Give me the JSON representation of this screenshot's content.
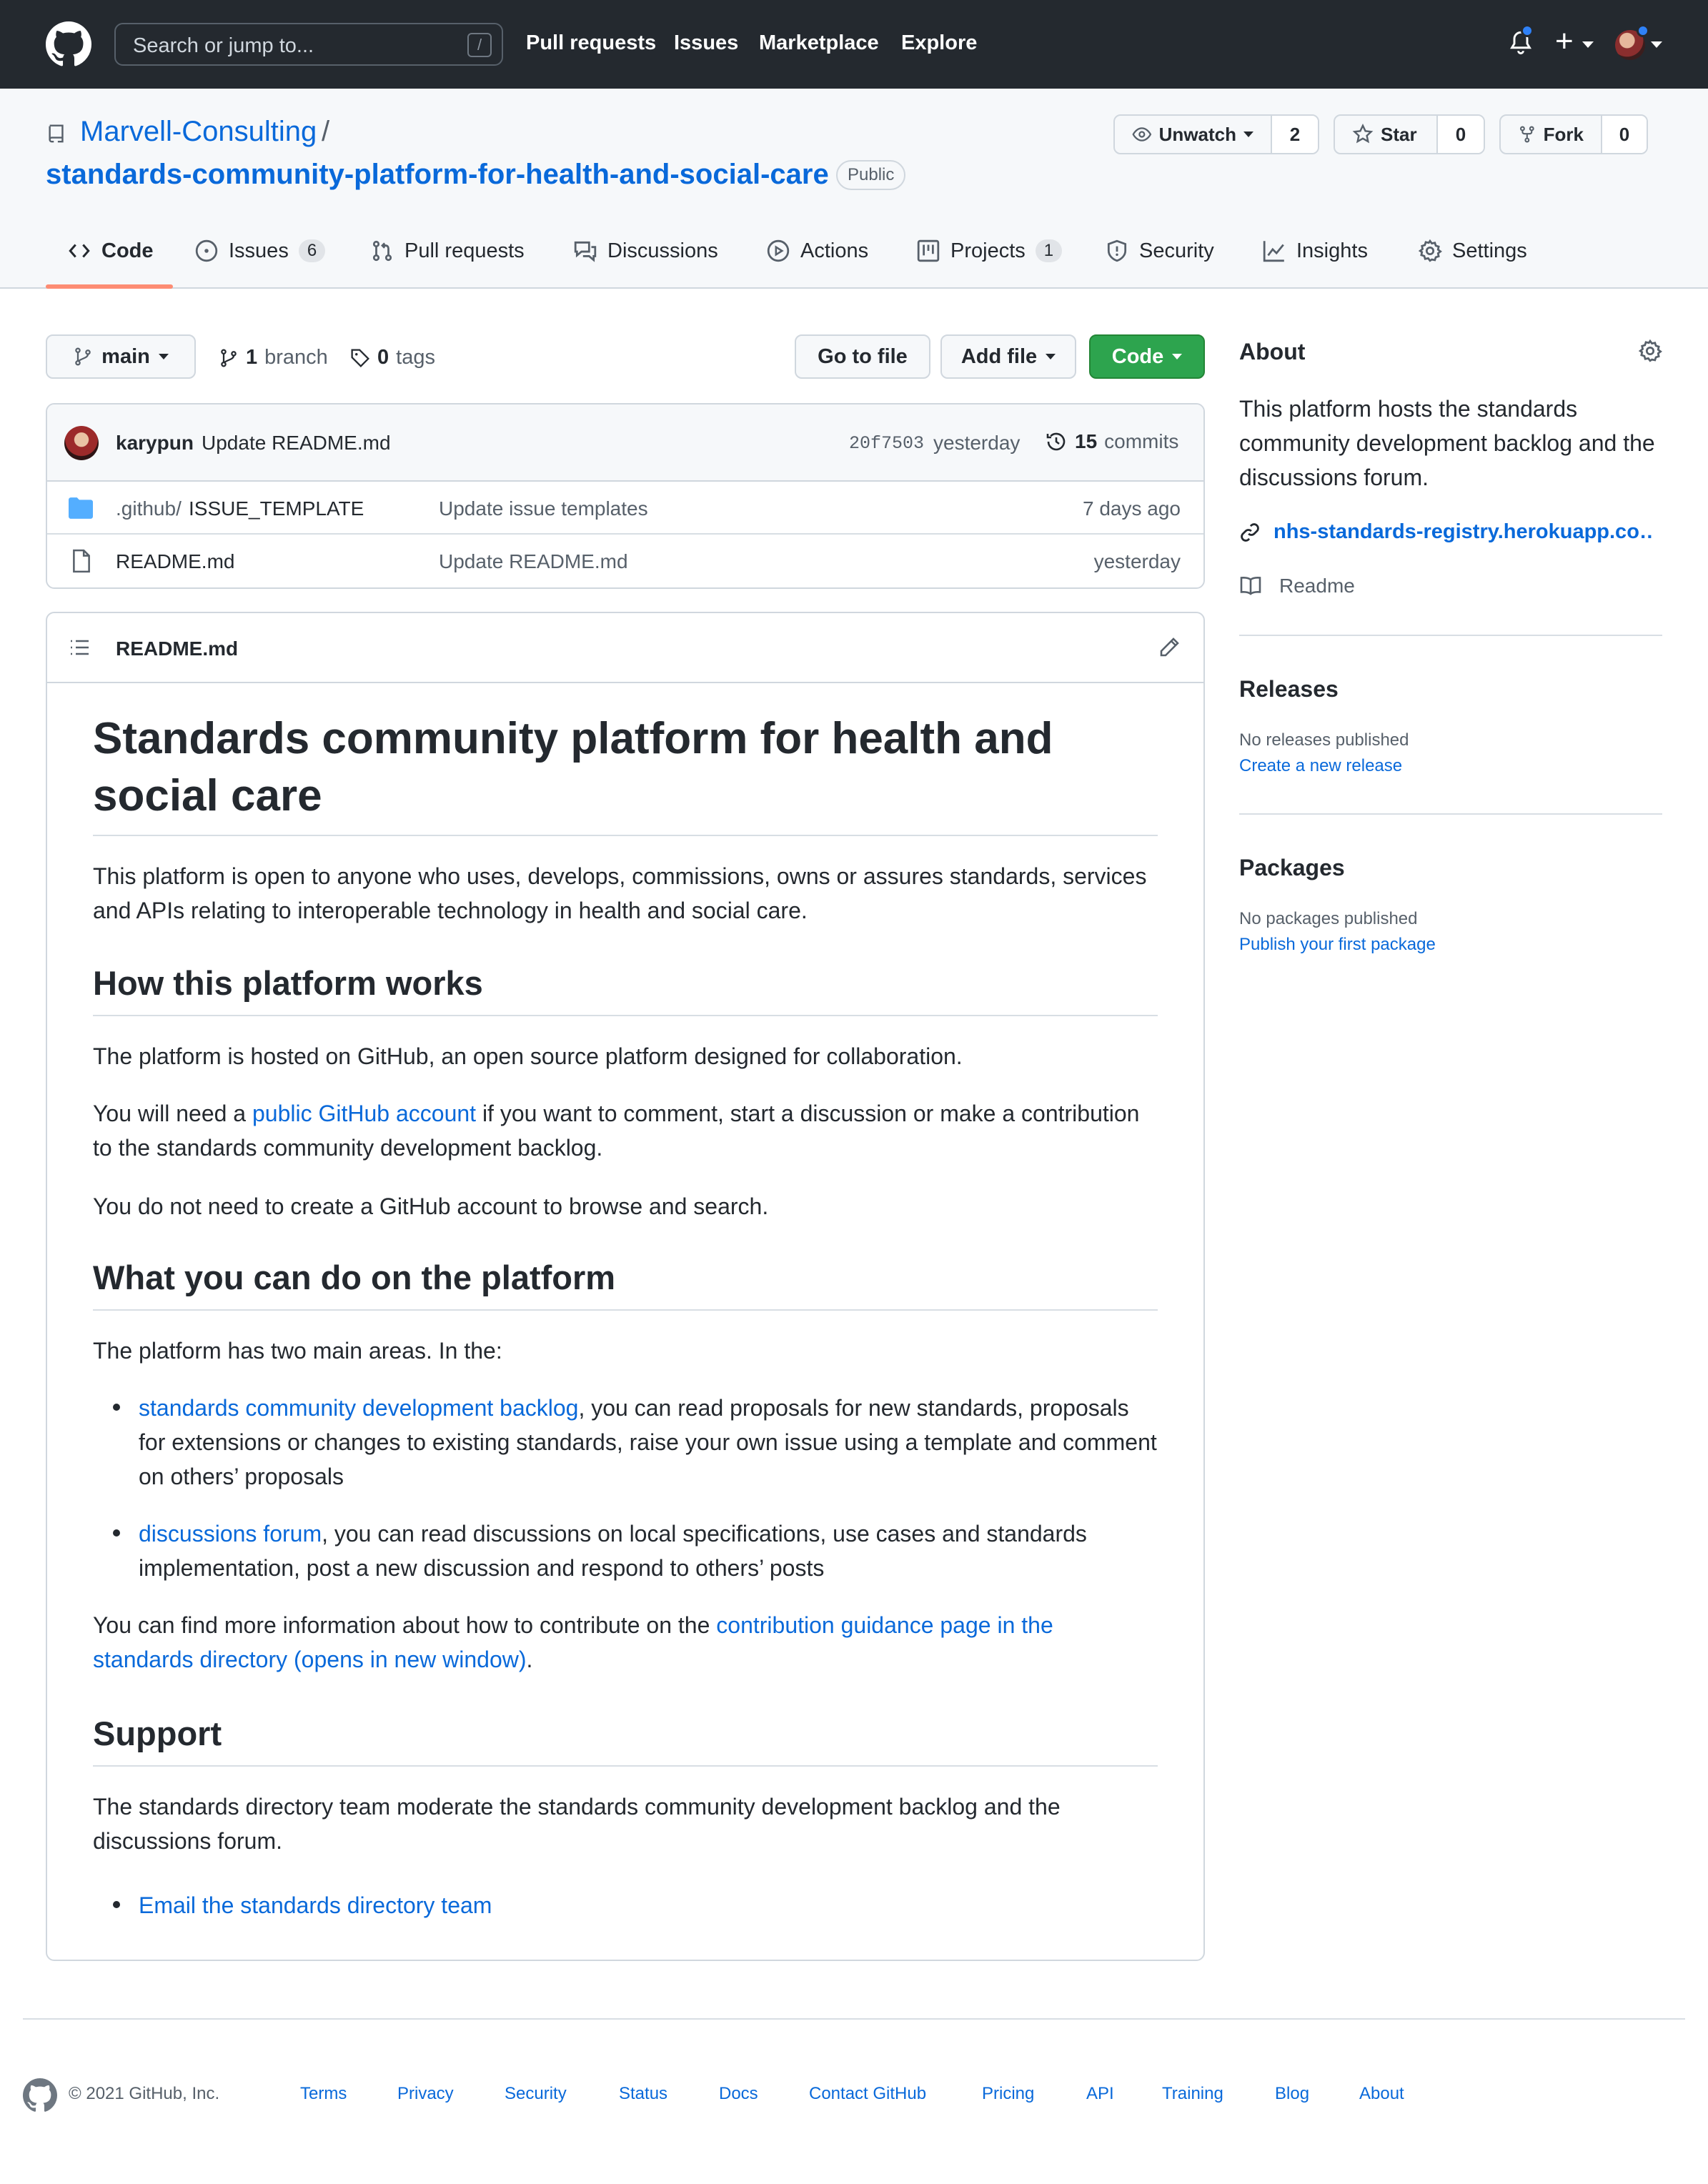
{
  "header": {
    "search_placeholder": "Search or jump to...",
    "search_key": "/",
    "nav": [
      "Pull requests",
      "Issues",
      "Marketplace",
      "Explore"
    ]
  },
  "repo": {
    "owner": "Marvell-Consulting",
    "separator": "/",
    "name": "standards-community-platform-for-health-and-social-care",
    "visibility": "Public",
    "watch_label": "Unwatch",
    "watch_count": "2",
    "star_label": "Star",
    "star_count": "0",
    "fork_label": "Fork",
    "fork_count": "0"
  },
  "tabs": [
    {
      "label": "Code",
      "count": ""
    },
    {
      "label": "Issues",
      "count": "6"
    },
    {
      "label": "Pull requests",
      "count": ""
    },
    {
      "label": "Discussions",
      "count": ""
    },
    {
      "label": "Actions",
      "count": ""
    },
    {
      "label": "Projects",
      "count": "1"
    },
    {
      "label": "Security",
      "count": ""
    },
    {
      "label": "Insights",
      "count": ""
    },
    {
      "label": "Settings",
      "count": ""
    }
  ],
  "toolbar": {
    "branch": "main",
    "branch_count": "1",
    "branch_word": "branch",
    "tag_count": "0",
    "tag_word": "tags",
    "go_to_file": "Go to file",
    "add_file": "Add file",
    "code": "Code"
  },
  "commit": {
    "author": "karypun",
    "message": "Update README.md",
    "sha": "20f7503",
    "when": "yesterday",
    "count": "15",
    "count_word": "commits"
  },
  "files": [
    {
      "dir": ".github/",
      "name": "ISSUE_TEMPLATE",
      "message": "Update issue templates",
      "age": "7 days ago",
      "type": "folder"
    },
    {
      "dir": "",
      "name": "README.md",
      "message": "Update README.md",
      "age": "yesterday",
      "type": "file"
    }
  ],
  "readme": {
    "filename": "README.md",
    "title": "Standards community platform for health and social care",
    "intro": "This platform is open to anyone who uses, develops, commissions, owns or assures standards, services and APIs relating to interoperable technology in health and social care.",
    "h_works": "How this platform works",
    "p_hosted": "The platform is hosted on GitHub, an open source platform designed for collaboration.",
    "p_need_pre": "You will need a ",
    "p_need_link": "public GitHub account",
    "p_need_post": " if you want to comment, start a discussion or make a contribution to the standards community development backlog.",
    "p_noneed": "You do not need to create a GitHub account to browse and search.",
    "h_what": "What you can do on the platform",
    "p_two": "The platform has two main areas. In the:",
    "li1_link": "standards community development backlog",
    "li1_text": ", you can read proposals for new standards, proposals for extensions or changes to existing standards, raise your own issue using a template and comment on others’ proposals",
    "li2_link": "discussions forum",
    "li2_text": ", you can read discussions on local specifications, use cases and standards implementation, post a new discussion and respond to others’ posts",
    "p_more_pre": "You can find more information about how to contribute on the ",
    "p_more_link": "contribution guidance page in the standards directory (opens in new window)",
    "p_more_post": ".",
    "h_support": "Support",
    "p_support": "The standards directory team moderate the standards community development backlog and the discussions forum.",
    "li_email": "Email the standards directory team"
  },
  "about": {
    "heading": "About",
    "description": "This platform hosts the standards community development backlog and the discussions forum.",
    "website": "nhs-standards-registry.herokuapp.co…",
    "readme": "Readme",
    "releases_heading": "Releases",
    "releases_none": "No releases published",
    "releases_link": "Create a new release",
    "packages_heading": "Packages",
    "packages_none": "No packages published",
    "packages_link": "Publish your first package"
  },
  "footer": {
    "copyright": "© 2021 GitHub, Inc.",
    "links": [
      "Terms",
      "Privacy",
      "Security",
      "Status",
      "Docs",
      "Contact GitHub",
      "Pricing",
      "API",
      "Training",
      "Blog",
      "About"
    ]
  }
}
